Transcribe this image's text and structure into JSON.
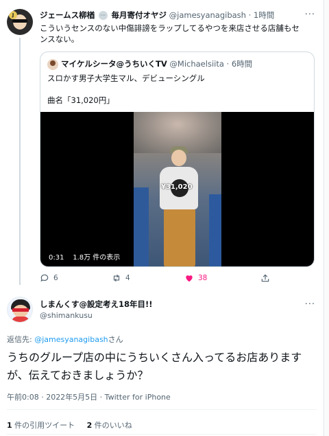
{
  "tweet1": {
    "author_name": "ジェームス柳楢",
    "author_badge": "毎月寄付オヤジ",
    "handle": "@jamesyanagibash",
    "time": "1時間",
    "text_line1": "こういうセンスのない中傷誹謗をラップしてるやつを来店させる店舗もセ",
    "text_line2": "ンスない。"
  },
  "quoted": {
    "author_name": "マイケルシータ@うちいくTV",
    "handle": "@Michaelsiita",
    "time": "6時間",
    "line1": "スロかす男子大学生マル、デビューシングル",
    "line2": "曲名「31,020円」",
    "video_overlay_text": "¥31,020",
    "video_duration": "0:31",
    "video_views": "1.8万 件の表示"
  },
  "actions": {
    "reply_count": "6",
    "retweet_count": "4",
    "like_count": "38"
  },
  "tweet2": {
    "author_name": "しまんくす@設定考え18年目!!",
    "handle": "@shimankusu",
    "reply_label": "返信先: ",
    "reply_mention": "@jamesyanagibash",
    "reply_suffix": "さん",
    "text": "うちのグループ店の中にうちいくさん入ってるお店ありますが、伝えておきましょうか？",
    "timestamp": "午前0:08 · 2022年5月5日 · Twitter for iPhone",
    "quote_count": "1",
    "quote_label": " 件の引用ツイート",
    "like_count": "2",
    "like_label": " 件のいいね"
  },
  "colors": {
    "accent": "#1d9bf0",
    "like": "#f91880",
    "secondary_text": "#536471"
  }
}
